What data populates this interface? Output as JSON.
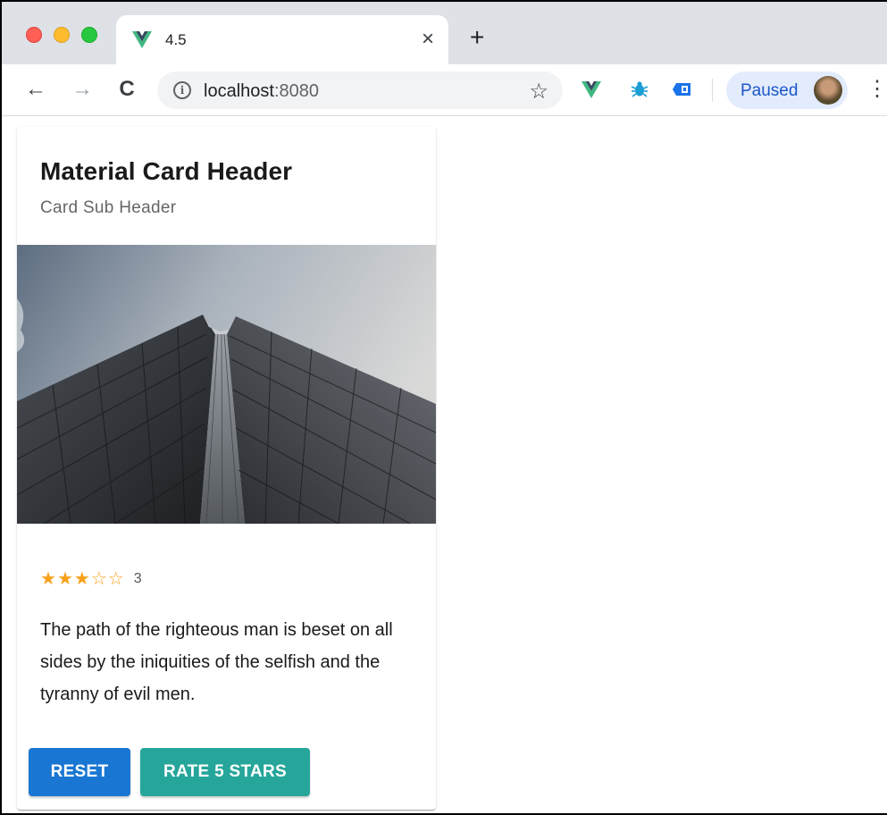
{
  "browser": {
    "tab": {
      "title": "4.5",
      "close_glyph": "×"
    },
    "new_tab_glyph": "+",
    "nav": {
      "back_glyph": "←",
      "forward_glyph": "→",
      "reload_glyph": "C"
    },
    "address": {
      "host": "localhost",
      "port": ":8080",
      "info_glyph": "i"
    },
    "bookmark_glyph": "☆",
    "extensions": [
      "vue-devtools-icon",
      "bug-icon",
      "chip-icon"
    ],
    "profile": {
      "label": "Paused"
    },
    "menu_glyph": "⋮"
  },
  "card": {
    "title": "Material Card Header",
    "subtitle": "Card Sub Header",
    "rating": {
      "value": 3,
      "max": 5,
      "label": "3",
      "filled_glyph": "★",
      "empty_glyph": "☆"
    },
    "body": "The path of the righteous man is beset on all sides by the iniquities of the selfish and the tyranny of evil men.",
    "buttons": {
      "reset": "RESET",
      "rate": "RATE 5 STARS"
    }
  },
  "colors": {
    "tabstrip": "#dee1e6",
    "star": "#f9a11b",
    "reset_button": "#1976d2",
    "rate_button": "#26a69a",
    "profile_chip": "#e3ecfd",
    "vue_green": "#41b883",
    "vue_dark": "#35495e"
  }
}
